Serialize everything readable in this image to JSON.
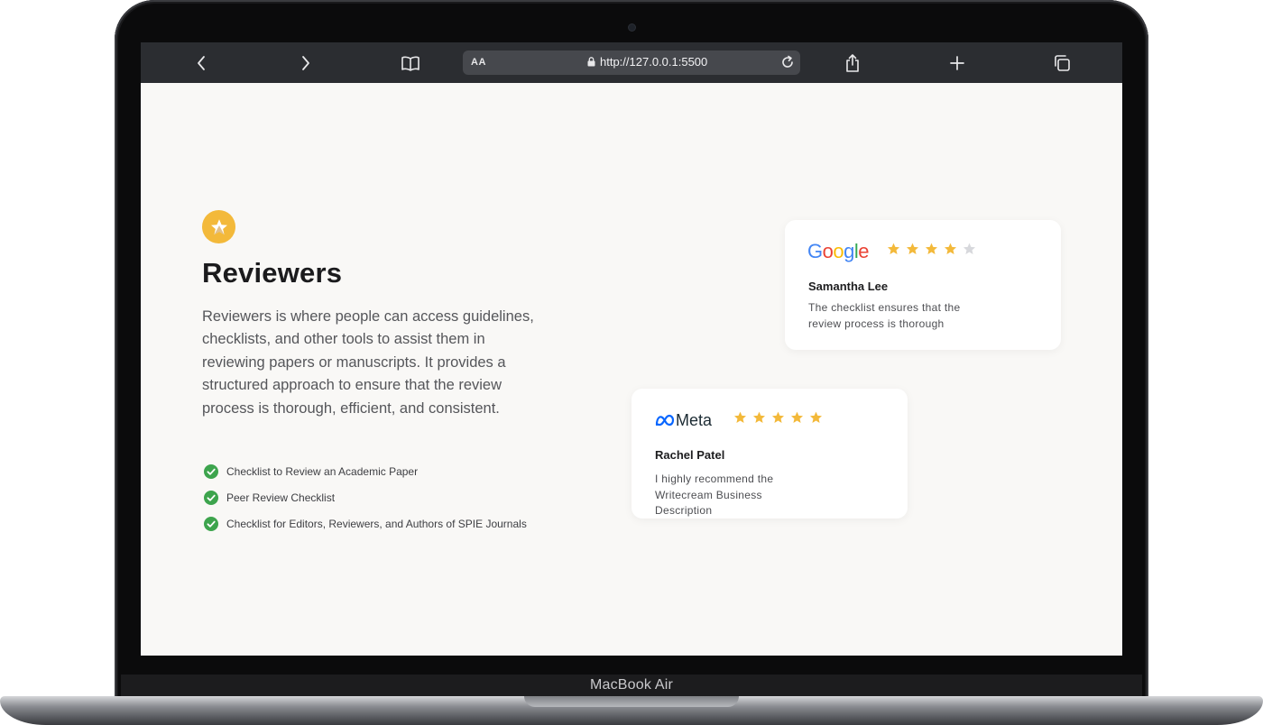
{
  "device": {
    "label": "MacBook Air"
  },
  "browser": {
    "text_size_label": "AA",
    "url": "http://127.0.0.1:5500",
    "icons": [
      "back-icon",
      "forward-icon",
      "bookmarks-icon",
      "lock-icon",
      "reload-icon",
      "share-icon",
      "new-tab-icon",
      "tabs-icon"
    ]
  },
  "section": {
    "icon": "star-badge-icon",
    "title": "Reviewers",
    "description": "Reviewers is where people can access guidelines, checklists, and other tools to assist them in reviewing papers or manuscripts. It provides a structured approach to ensure that the review process is thorough, efficient, and consistent.",
    "checklist": [
      "Checklist to Review an Academic Paper",
      "Peer Review Checklist",
      "Checklist for Editors, Reviewers, and Authors of SPIE Journals"
    ]
  },
  "reviews": [
    {
      "platform_logo": "Google",
      "rating": 4,
      "max_rating": 5,
      "name": "Samantha Lee",
      "quote": "The checklist ensures that the review process is thorough"
    },
    {
      "platform_logo": "Meta",
      "rating": 5,
      "max_rating": 5,
      "name": "Rachel Patel",
      "quote": "I highly recommend the Writecream Business Description"
    }
  ],
  "colors": {
    "accent_star": "#f3b93a",
    "check_green": "#3da44d",
    "page_background": "#f9f8f6",
    "toolbar": "#2b2d31",
    "star_empty": "#d7d8dc"
  }
}
